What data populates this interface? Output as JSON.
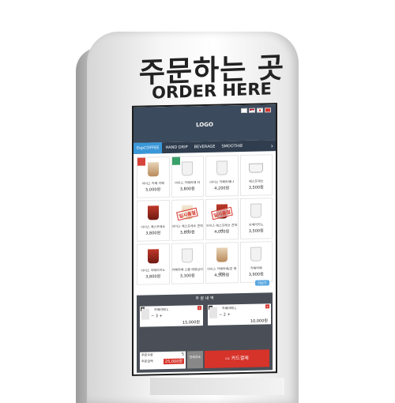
{
  "sign": {
    "title_ko": "주문하는 곳",
    "title_en": "ORDER HERE"
  },
  "header": {
    "logo": "LOGO"
  },
  "tabs": [
    {
      "label": "EspCOFFEE",
      "active": true
    },
    {
      "label": "HAND DRIP",
      "active": false
    },
    {
      "label": "BEVERAGE",
      "active": false
    },
    {
      "label": "SMOOTHIE",
      "active": false
    }
  ],
  "products": [
    {
      "name": "아이스 카페 카페",
      "price": "5,000원",
      "cup": "latte",
      "ribbon": "new-red"
    },
    {
      "name": "아이스 카페라떼 라",
      "price": "3,800원",
      "cup": "white",
      "ribbon": "new-green"
    },
    {
      "name": "아이스 카페라떼나",
      "price": "4,200원",
      "cup": "white",
      "ribbon": ""
    },
    {
      "name": "에스프레소",
      "price": "3,500원",
      "cup": "mug",
      "ribbon": ""
    },
    {
      "name": "아이스 에스프레소",
      "price": "3,800원",
      "cup": "red",
      "ribbon": "",
      "stamp": ""
    },
    {
      "name": "아이스 에스프레소 콘파냐",
      "price": "3,800원",
      "cup": "cream",
      "ribbon": "",
      "stamp": "일시품절"
    },
    {
      "name": "아이스 에스프레소 콘파냐",
      "price": "4,000원",
      "cup": "red",
      "ribbon": "",
      "stamp": "일시품절"
    },
    {
      "name": "아메리카노",
      "price": "3,500원",
      "cup": "white",
      "ribbon": ""
    },
    {
      "name": "아이스 아메리카노",
      "price": "3,800원",
      "cup": "red",
      "ribbon": ""
    },
    {
      "name": "카페라떼 스몰 매장남아",
      "price": "3,300원",
      "cup": "white",
      "ribbon": ""
    },
    {
      "name": "아이스 카페라떼/콘 매장남",
      "price": "4,500원",
      "cup": "latte",
      "ribbon": ""
    },
    {
      "name": "카페라떼",
      "price": "3,900원",
      "cup": "white",
      "ribbon": ""
    }
  ],
  "more_label": "더보기",
  "order": {
    "title": "주 문 내 역",
    "items": [
      {
        "badge": "1",
        "name": "카페라떼 L",
        "qty": "3",
        "price": "15,000원"
      },
      {
        "badge": "2",
        "name": "카페라떼 L",
        "qty": "2",
        "price": "10,000원"
      }
    ],
    "qty_label": "주문수량",
    "qty_value": "5",
    "total_label": "주문금액",
    "total_value": "25,000원",
    "cancel_label": "전체취소",
    "pay_label": "카드결제"
  },
  "colors": {
    "header": "#3b4a5c",
    "tab_active": "#3a97d8",
    "accent_red": "#d6332a"
  }
}
